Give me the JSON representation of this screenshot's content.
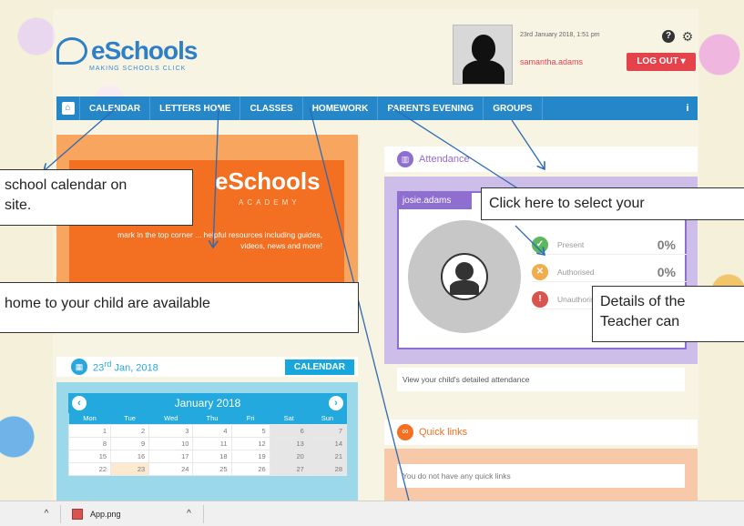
{
  "header": {
    "logo_text": "eSchools",
    "logo_tagline": "MAKING SCHOOLS CLICK",
    "timestamp": "23rd January 2018, 1:51 pm",
    "username": "samantha.adams",
    "logout_label": "LOG OUT ▾"
  },
  "nav": {
    "items": [
      "CALENDAR",
      "LETTERS HOME",
      "CLASSES",
      "HOMEWORK",
      "PARENTS EVENING",
      "GROUPS"
    ]
  },
  "promo": {
    "brand": "eSchools",
    "sub": "ACADEMY",
    "text": "mark in the top corner ... helpful resources including guides, videos, news and more!"
  },
  "calendar": {
    "date": "23rd Jan, 2018",
    "button_label": "CALENDAR",
    "month_label": "January 2018",
    "weekdays": [
      "Mon",
      "Tue",
      "Wed",
      "Thu",
      "Fri",
      "Sat",
      "Sun"
    ],
    "weeks": [
      [
        "1",
        "2",
        "3",
        "4",
        "5",
        "6",
        "7"
      ],
      [
        "8",
        "9",
        "10",
        "11",
        "12",
        "13",
        "14"
      ],
      [
        "15",
        "16",
        "17",
        "18",
        "19",
        "20",
        "21"
      ],
      [
        "22",
        "23",
        "24",
        "25",
        "26",
        "27",
        "28"
      ]
    ]
  },
  "attendance": {
    "title": "Attendance",
    "child_name": "josie.adams",
    "rows": [
      {
        "label": "Present",
        "value": "0%",
        "color": "#5cb85c",
        "icon": "✓"
      },
      {
        "label": "Authorised",
        "value": "0%",
        "color": "#f0ad4e",
        "icon": "✕"
      },
      {
        "label": "Unauthorised",
        "value": "",
        "color": "#d9534f",
        "icon": "!"
      }
    ],
    "link_text": "View your child's detailed attendance"
  },
  "quick_links": {
    "title": "Quick links",
    "empty_text": "You do not have any quick links"
  },
  "callouts": {
    "calendar": "school calendar on\nsite.",
    "letters": "home to your child are available",
    "select": "Click here to select your",
    "details": "Details of the\nTeacher can"
  },
  "taskbar": {
    "file_name": "App.png"
  }
}
